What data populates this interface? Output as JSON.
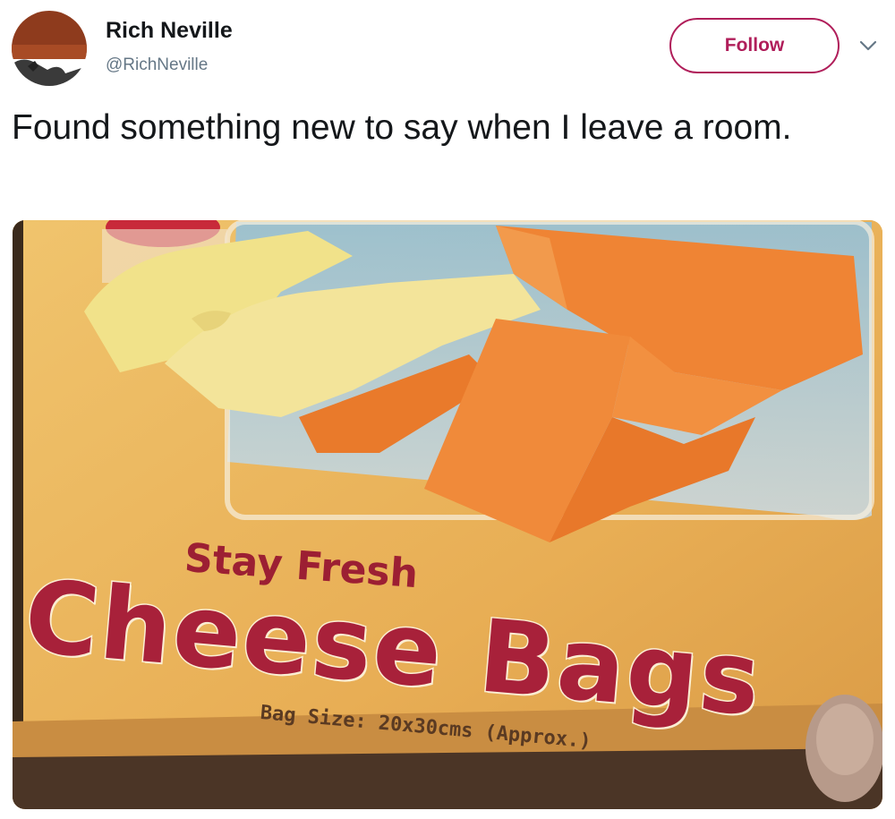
{
  "tweet": {
    "author_name": "Rich Neville",
    "author_handle": "@RichNeville",
    "follow_label": "Follow",
    "text": "Found something new to say when I leave a room."
  },
  "photo": {
    "tagline": "Stay Fresh",
    "product_name": "Cheese Bags",
    "bag_size": "Bag Size: 20x30cms (Approx.)"
  },
  "colors": {
    "follow_accent": "#b01e5a",
    "package_yellow": "#e9b35a",
    "package_red": "#a8213a"
  },
  "icons": [
    "avatar",
    "chevron-down-icon"
  ]
}
